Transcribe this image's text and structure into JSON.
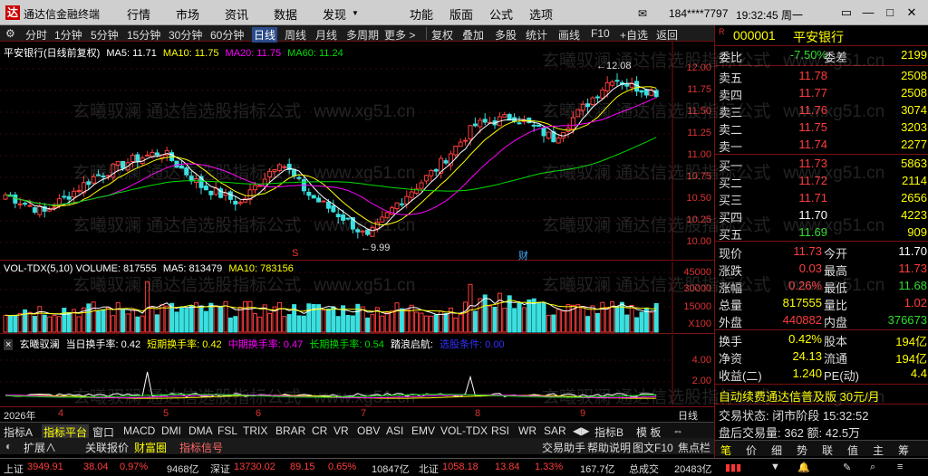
{
  "app": {
    "title": "通达信金融终端",
    "menu": [
      "行情",
      "市场",
      "资讯",
      "数据",
      "发现",
      "功能",
      "版面",
      "公式",
      "选项"
    ],
    "user": "184****7797",
    "time": "19:32:45 周一"
  },
  "toolbar": {
    "items": [
      "分时",
      "1分钟",
      "5分钟",
      "15分钟",
      "30分钟",
      "60分钟",
      "日线",
      "周线",
      "月线",
      "多周期",
      "更多 >",
      "复权",
      "叠加",
      "多股",
      "统计",
      "画线",
      "F10",
      "+自选",
      "返回"
    ],
    "active": "日线"
  },
  "chart": {
    "title": "平安银行(日线前复权)",
    "ma": [
      {
        "label": "MA5: 11.71",
        "color": "#ffffff"
      },
      {
        "label": "MA10: 11.75",
        "color": "#ffff00"
      },
      {
        "label": "MA20: 11.75",
        "color": "#ff00ff"
      },
      {
        "label": "MA60: 11.24",
        "color": "#00dd00"
      }
    ],
    "price_axis": [
      "12.00",
      "11.75",
      "11.50",
      "11.25",
      "11.00",
      "10.75",
      "10.50",
      "10.25",
      "10.00"
    ],
    "high_label": "12.08",
    "low_label": "9.99",
    "marker_s": "S",
    "marker_cai": "财"
  },
  "volume": {
    "title": "VOL-TDX(5,10) VOLUME: 817555",
    "ma5": "MA5: 813479",
    "ma10": "MA10: 783156",
    "axis": [
      "45000",
      "30000",
      "15000",
      "X100"
    ]
  },
  "indicator": {
    "name": "玄曦驭澜",
    "items": [
      {
        "label": "当日换手率: 0.42",
        "color": "#ffffff"
      },
      {
        "label": "短期换手率: 0.42",
        "color": "#ffff00"
      },
      {
        "label": "中期换手率: 0.47",
        "color": "#ff00ff"
      },
      {
        "label": "长期换手率: 0.54",
        "color": "#00dd00"
      },
      {
        "label": "踏浪启航:",
        "color": "#ffffff"
      },
      {
        "label": "选股条件: 0.00",
        "color": "#3030ff"
      }
    ],
    "axis": [
      "4.00",
      "2.00"
    ]
  },
  "dates": {
    "year": "2026年",
    "months": [
      "4",
      "5",
      "6",
      "7",
      "8",
      "9"
    ],
    "mode": "日线"
  },
  "bottom_tabs": [
    "指标A",
    "指标平台",
    "窗口",
    "MACD",
    "DMI",
    "DMA",
    "FSL",
    "TRIX",
    "BRAR",
    "CR",
    "VR",
    "OBV",
    "ASI",
    "EMV",
    "VOL-TDX",
    "RSI",
    "WR",
    "SAR",
    "指标B",
    "模 板"
  ],
  "quick_bar": {
    "left": "扩展∧",
    "items": [
      "关联报价",
      "财富圈",
      "指标信号"
    ],
    "right": [
      "交易助手",
      "帮助说明",
      "图文F10",
      "焦点栏"
    ]
  },
  "watermark": {
    "line1": "玄曦驭澜 通达信选股指标公式",
    "line2": "www.xg51.cn"
  },
  "panel": {
    "code": "000001",
    "name": "平安银行",
    "weibi_label": "委比",
    "weibi": "-7.50%",
    "weicha_label": "委差",
    "weicha": "2199",
    "sell": [
      {
        "label": "卖五",
        "price": "11.78",
        "vol": "2508"
      },
      {
        "label": "卖四",
        "price": "11.77",
        "vol": "2508"
      },
      {
        "label": "卖三",
        "price": "11.76",
        "vol": "3074"
      },
      {
        "label": "卖二",
        "price": "11.75",
        "vol": "3203"
      },
      {
        "label": "卖一",
        "price": "11.74",
        "vol": "2277"
      }
    ],
    "buy": [
      {
        "label": "买一",
        "price": "11.73",
        "vol": "5863"
      },
      {
        "label": "买二",
        "price": "11.72",
        "vol": "2114"
      },
      {
        "label": "买三",
        "price": "11.71",
        "vol": "2656"
      },
      {
        "label": "买四",
        "price": "11.70",
        "vol": "4223"
      },
      {
        "label": "买五",
        "price": "11.69",
        "vol": "909"
      }
    ],
    "stats": [
      {
        "k1": "现价",
        "v1": "11.73",
        "k2": "今开",
        "v2": "11.70"
      },
      {
        "k1": "涨跌",
        "v1": "0.03",
        "k2": "最高",
        "v2": "11.73"
      },
      {
        "k1": "涨幅",
        "v1": "0.26%",
        "k2": "最低",
        "v2": "11.68"
      },
      {
        "k1": "总量",
        "v1": "817555",
        "k2": "量比",
        "v2": "1.02"
      },
      {
        "k1": "外盘",
        "v1": "440882",
        "k2": "内盘",
        "v2": "376673"
      }
    ],
    "stats2": [
      {
        "k1": "换手",
        "v1": "0.42%",
        "k2": "股本",
        "v2": "194亿"
      },
      {
        "k1": "净资",
        "v1": "24.13",
        "k2": "流通",
        "v2": "194亿"
      },
      {
        "k1": "收益(二)",
        "v1": "1.240",
        "k2": "PE(动)",
        "v2": "4.4"
      }
    ],
    "ad": "自动续费通达信普及版 30元/月",
    "trade_status": "交易状态: 闭市阶段 15:32:52",
    "after_hours": "盘后交易量: 362 额: 42.5万",
    "tabs": [
      "笔",
      "价",
      "细",
      "势",
      "联",
      "值",
      "主",
      "筹"
    ]
  },
  "statusbar": {
    "items": [
      {
        "label": "上证",
        "value": "3949.91",
        "chg": "38.04",
        "pct": "0.97%",
        "amt": "9468亿"
      },
      {
        "label": "深证",
        "value": "13730.02",
        "chg": "89.15",
        "pct": "0.65%",
        "amt": "10847亿"
      },
      {
        "label": "北证",
        "value": "1058.18",
        "chg": "13.84",
        "pct": "1.33%",
        "amt": "167.7亿"
      }
    ],
    "total_label": "总成交",
    "total": "20483亿"
  }
}
